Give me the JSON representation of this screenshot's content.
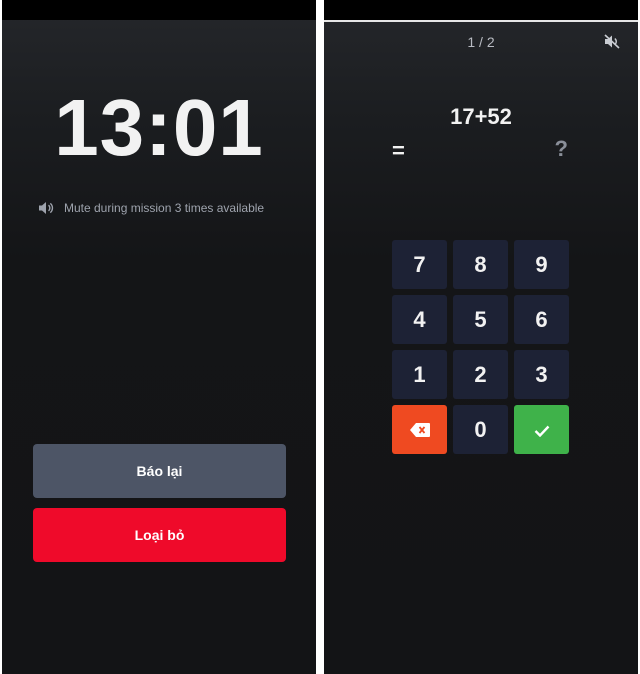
{
  "alarm_screen": {
    "time": "13:01",
    "mute_text": "Mute during mission 3 times available",
    "snooze_label": "Báo lại",
    "dismiss_label": "Loại bỏ"
  },
  "mission_screen": {
    "progress": "1 / 2",
    "question": "17+52",
    "equals": "=",
    "answer_placeholder": "?",
    "keys": {
      "k7": "7",
      "k8": "8",
      "k9": "9",
      "k4": "4",
      "k5": "5",
      "k6": "6",
      "k1": "1",
      "k2": "2",
      "k3": "3",
      "k0": "0"
    }
  },
  "icons": {
    "speaker": "speaker-icon",
    "mute": "speaker-muted-icon",
    "backspace": "backspace-icon",
    "confirm": "checkmark-icon"
  },
  "colors": {
    "snooze_button": "#4d5566",
    "dismiss_button": "#ef0a2a",
    "keypad_key": "#1d2235",
    "delete_key": "#ef4a21",
    "confirm_key": "#3fb24a"
  }
}
